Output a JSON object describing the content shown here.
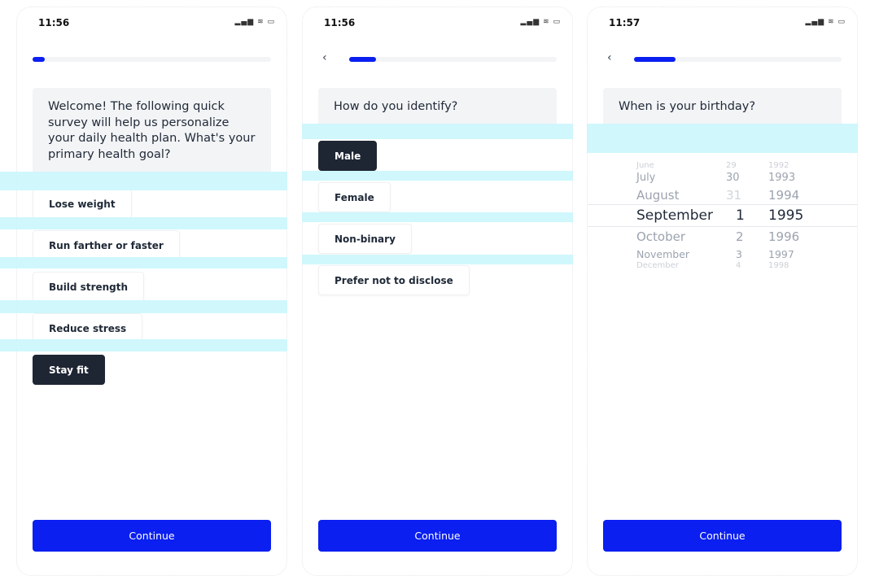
{
  "screens": [
    {
      "time": "11:56",
      "progress": 0.05,
      "question": "Welcome! The following quick survey will help us personalize your daily health plan. What's your primary health goal?",
      "options": [
        "Lose weight",
        "Run farther or faster",
        "Build strength",
        "Reduce stress",
        "Stay fit"
      ],
      "selected": "Stay fit",
      "cta": "Continue"
    },
    {
      "time": "11:56",
      "progress": 0.13,
      "question": "How do you identify?",
      "options": [
        "Male",
        "Female",
        "Non-binary",
        "Prefer not to disclose"
      ],
      "selected": "Male",
      "cta": "Continue"
    },
    {
      "time": "11:57",
      "progress": 0.2,
      "question": "When is your birthday?",
      "picker": {
        "months": [
          "June",
          "July",
          "August",
          "September",
          "October",
          "November",
          "December"
        ],
        "days": [
          "29",
          "30",
          "31",
          "1",
          "2",
          "3",
          "4"
        ],
        "years": [
          "1992",
          "1993",
          "1994",
          "1995",
          "1996",
          "1997",
          "1998"
        ],
        "selected": {
          "month": "September",
          "day": "1",
          "year": "1995"
        }
      },
      "cta": "Continue"
    }
  ],
  "colors": {
    "accent": "#0a1ff0",
    "selected": "#1e2533",
    "highlight": "#ccf7fc"
  }
}
